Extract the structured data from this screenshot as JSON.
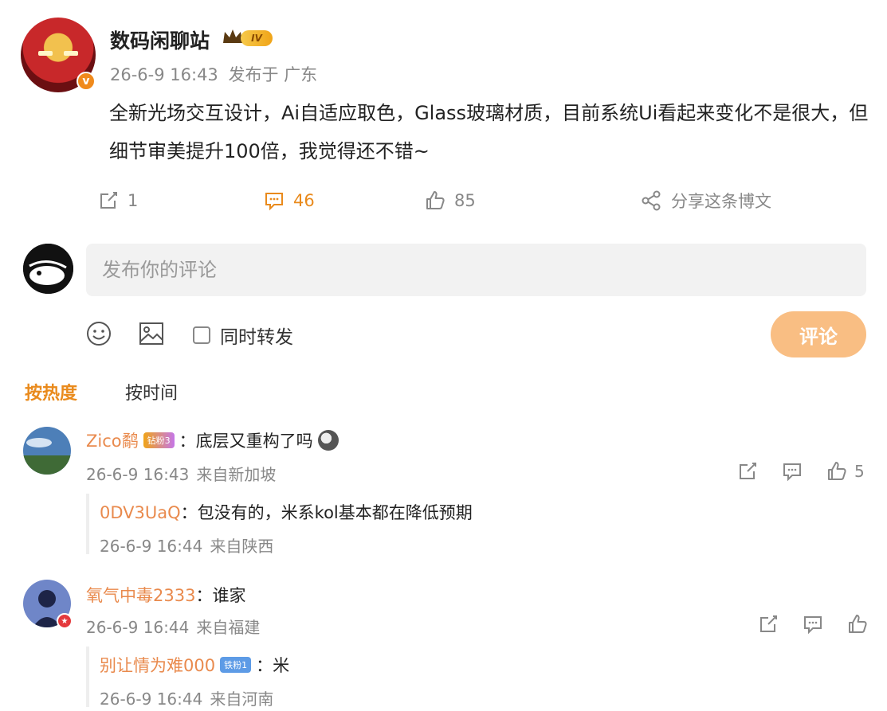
{
  "post": {
    "author": "数码闲聊站",
    "level": "IV",
    "time": "26-6-9 16:43",
    "location": "发布于 广东",
    "text": "全新光场交互设计，Ai自适应取色，Glass玻璃材质，目前系统Ui看起来变化不是很大，但细节审美提升100倍，我觉得还不错~",
    "repost_count": "1",
    "comment_count": "46",
    "like_count": "85",
    "share_label": "分享这条博文"
  },
  "composer": {
    "placeholder": "发布你的评论",
    "repost_label": "同时转发",
    "submit_label": "评论"
  },
  "sort": {
    "hot": "按热度",
    "time": "按时间"
  },
  "comments": [
    {
      "name": "Zico鹬",
      "medal": "钻粉3",
      "text": "：底层又重构了吗",
      "time": "26-6-9 16:43",
      "location": "来自新加坡",
      "likes": "5",
      "reply": {
        "name": "0DV3UaQ",
        "text": "：包没有的，米系kol基本都在降低预期",
        "time": "26-6-9 16:44",
        "location": "来自陕西"
      }
    },
    {
      "name": "氧气中毒2333",
      "text": "：谁家",
      "time": "26-6-9 16:44",
      "location": "来自福建",
      "likes": "",
      "reply": {
        "name": "别让情为难000",
        "medal": "铁粉1",
        "text": "：米",
        "time": "26-6-9 16:44",
        "location": "来自河南"
      }
    }
  ],
  "colors": {
    "accent": "#e98a1c",
    "username": "#e98a4d",
    "submit_bg": "#f9be83",
    "muted": "#888888"
  }
}
